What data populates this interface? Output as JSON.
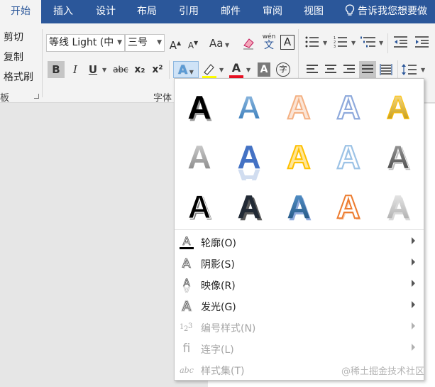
{
  "tabs": [
    {
      "label": "开始",
      "active": true
    },
    {
      "label": "插入"
    },
    {
      "label": "设计"
    },
    {
      "label": "布局"
    },
    {
      "label": "引用"
    },
    {
      "label": "邮件"
    },
    {
      "label": "审阅"
    },
    {
      "label": "视图"
    }
  ],
  "tell_me": "告诉我您想要做",
  "clipboard": {
    "cut": "剪切",
    "copy": "复制",
    "format_painter": "格式刷",
    "group_label": "板"
  },
  "font": {
    "font_name": "等线 Light (中",
    "font_size": "三号",
    "group_label": "字体",
    "bold": "B",
    "italic": "I",
    "underline": "U",
    "strikethrough": "abc",
    "subscript": "x₂",
    "superscript": "x²",
    "grow": "A",
    "shrink": "A",
    "change_case": "Aa",
    "phonetic_top": "wén",
    "phonetic_bottom": "文",
    "char_border": "A",
    "text_effects": "A",
    "font_color": "A",
    "char_shading": "A",
    "enclose": "字"
  },
  "colors": {
    "brand": "#2b579a",
    "highlight": "#ffff00",
    "font_color": "#e81123"
  },
  "gallery": {
    "letter": "A",
    "styles": [
      "black-shadow",
      "blue-gradient",
      "orange-outline",
      "blue-outline",
      "gold-outline",
      "gray-gradient",
      "blue-reflection",
      "gold-fill",
      "light-blue-outline",
      "gray-bevel",
      "black-white-outline",
      "dark-3d",
      "blue-3d",
      "orange-3d",
      "white-gray"
    ]
  },
  "menu": [
    {
      "label": "轮廓(O)",
      "icon": "outline-icon",
      "enabled": true,
      "submenu": true
    },
    {
      "label": "阴影(S)",
      "icon": "shadow-icon",
      "enabled": true,
      "submenu": true
    },
    {
      "label": "映像(R)",
      "icon": "reflection-icon",
      "enabled": true,
      "submenu": true
    },
    {
      "label": "发光(G)",
      "icon": "glow-icon",
      "enabled": true,
      "submenu": true
    },
    {
      "label": "编号样式(N)",
      "icon": "number-style-icon",
      "enabled": false,
      "submenu": true
    },
    {
      "label": "连字(L)",
      "icon": "ligature-icon",
      "enabled": false,
      "submenu": true
    },
    {
      "label": "样式集(T)",
      "icon": "stylistic-set-icon",
      "enabled": false,
      "submenu": false
    }
  ],
  "watermark": "@稀土掘金技术社区"
}
